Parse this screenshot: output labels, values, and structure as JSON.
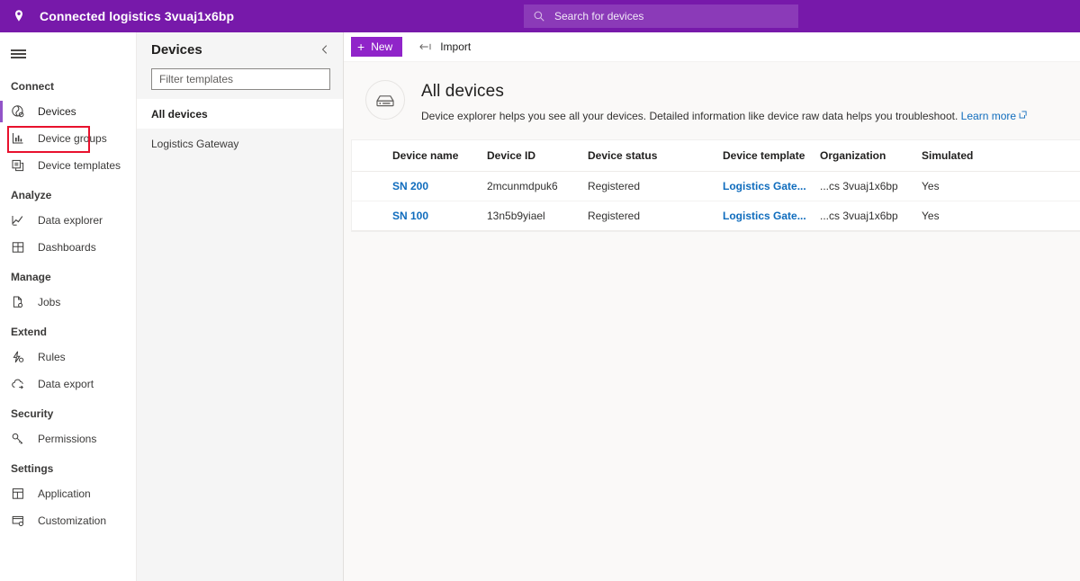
{
  "header": {
    "brand_icon": "location-pin-icon",
    "title": "Connected logistics 3vuaj1x6bp",
    "search_placeholder": "Search for devices",
    "search_icon": "search-icon",
    "accent_color": "#7719aa"
  },
  "leftnav": {
    "menu_icon": "hamburger-icon",
    "groups": [
      {
        "title": "Connect",
        "items": [
          {
            "label": "Devices",
            "icon": "devices-icon",
            "selected": true,
            "highlighted": true
          },
          {
            "label": "Device groups",
            "icon": "device-groups-icon",
            "selected": false,
            "highlighted": false
          },
          {
            "label": "Device templates",
            "icon": "device-templates-icon",
            "selected": false,
            "highlighted": false
          }
        ]
      },
      {
        "title": "Analyze",
        "items": [
          {
            "label": "Data explorer",
            "icon": "line-chart-icon",
            "selected": false,
            "highlighted": false
          },
          {
            "label": "Dashboards",
            "icon": "dashboard-grid-icon",
            "selected": false,
            "highlighted": false
          }
        ]
      },
      {
        "title": "Manage",
        "items": [
          {
            "label": "Jobs",
            "icon": "jobs-icon",
            "selected": false,
            "highlighted": false
          }
        ]
      },
      {
        "title": "Extend",
        "items": [
          {
            "label": "Rules",
            "icon": "rules-icon",
            "selected": false,
            "highlighted": false
          },
          {
            "label": "Data export",
            "icon": "cloud-export-icon",
            "selected": false,
            "highlighted": false
          }
        ]
      },
      {
        "title": "Security",
        "items": [
          {
            "label": "Permissions",
            "icon": "key-icon",
            "selected": false,
            "highlighted": false
          }
        ]
      },
      {
        "title": "Settings",
        "items": [
          {
            "label": "Application",
            "icon": "application-icon",
            "selected": false,
            "highlighted": false
          },
          {
            "label": "Customization",
            "icon": "customization-icon",
            "selected": false,
            "highlighted": false
          }
        ]
      }
    ],
    "highlight_color": "#e8112d",
    "active_bar_color": "#9254c8"
  },
  "devicepanel": {
    "title": "Devices",
    "collapse_icon": "chevron-left-icon",
    "filter_placeholder": "Filter templates",
    "filter_value": "",
    "items": [
      {
        "label": "All devices",
        "selected": true
      },
      {
        "label": "Logistics Gateway",
        "selected": false
      }
    ]
  },
  "commandbar": {
    "new_label": "New",
    "new_icon": "plus-icon",
    "import_label": "Import",
    "import_icon": "import-arrow-icon",
    "new_button_color": "#9024c9"
  },
  "page": {
    "icon": "device-box-icon",
    "title": "All devices",
    "description": "Device explorer helps you see all your devices. Detailed information like device raw data helps you troubleshoot.",
    "learn_more_label": "Learn more",
    "learn_more_icon": "external-link-icon",
    "link_color": "#0f6cbd"
  },
  "table": {
    "columns": [
      "Device name",
      "Device ID",
      "Device status",
      "Device template",
      "Organization",
      "Simulated"
    ],
    "rows": [
      {
        "device_name": "SN 200",
        "device_id": "2mcunmdpuk6",
        "device_status": "Registered",
        "device_template": "Logistics Gate...",
        "organization": "...cs 3vuaj1x6bp",
        "simulated": "Yes"
      },
      {
        "device_name": "SN 100",
        "device_id": "13n5b9yiael",
        "device_status": "Registered",
        "device_template": "Logistics Gate...",
        "organization": "...cs 3vuaj1x6bp",
        "simulated": "Yes"
      }
    ]
  }
}
